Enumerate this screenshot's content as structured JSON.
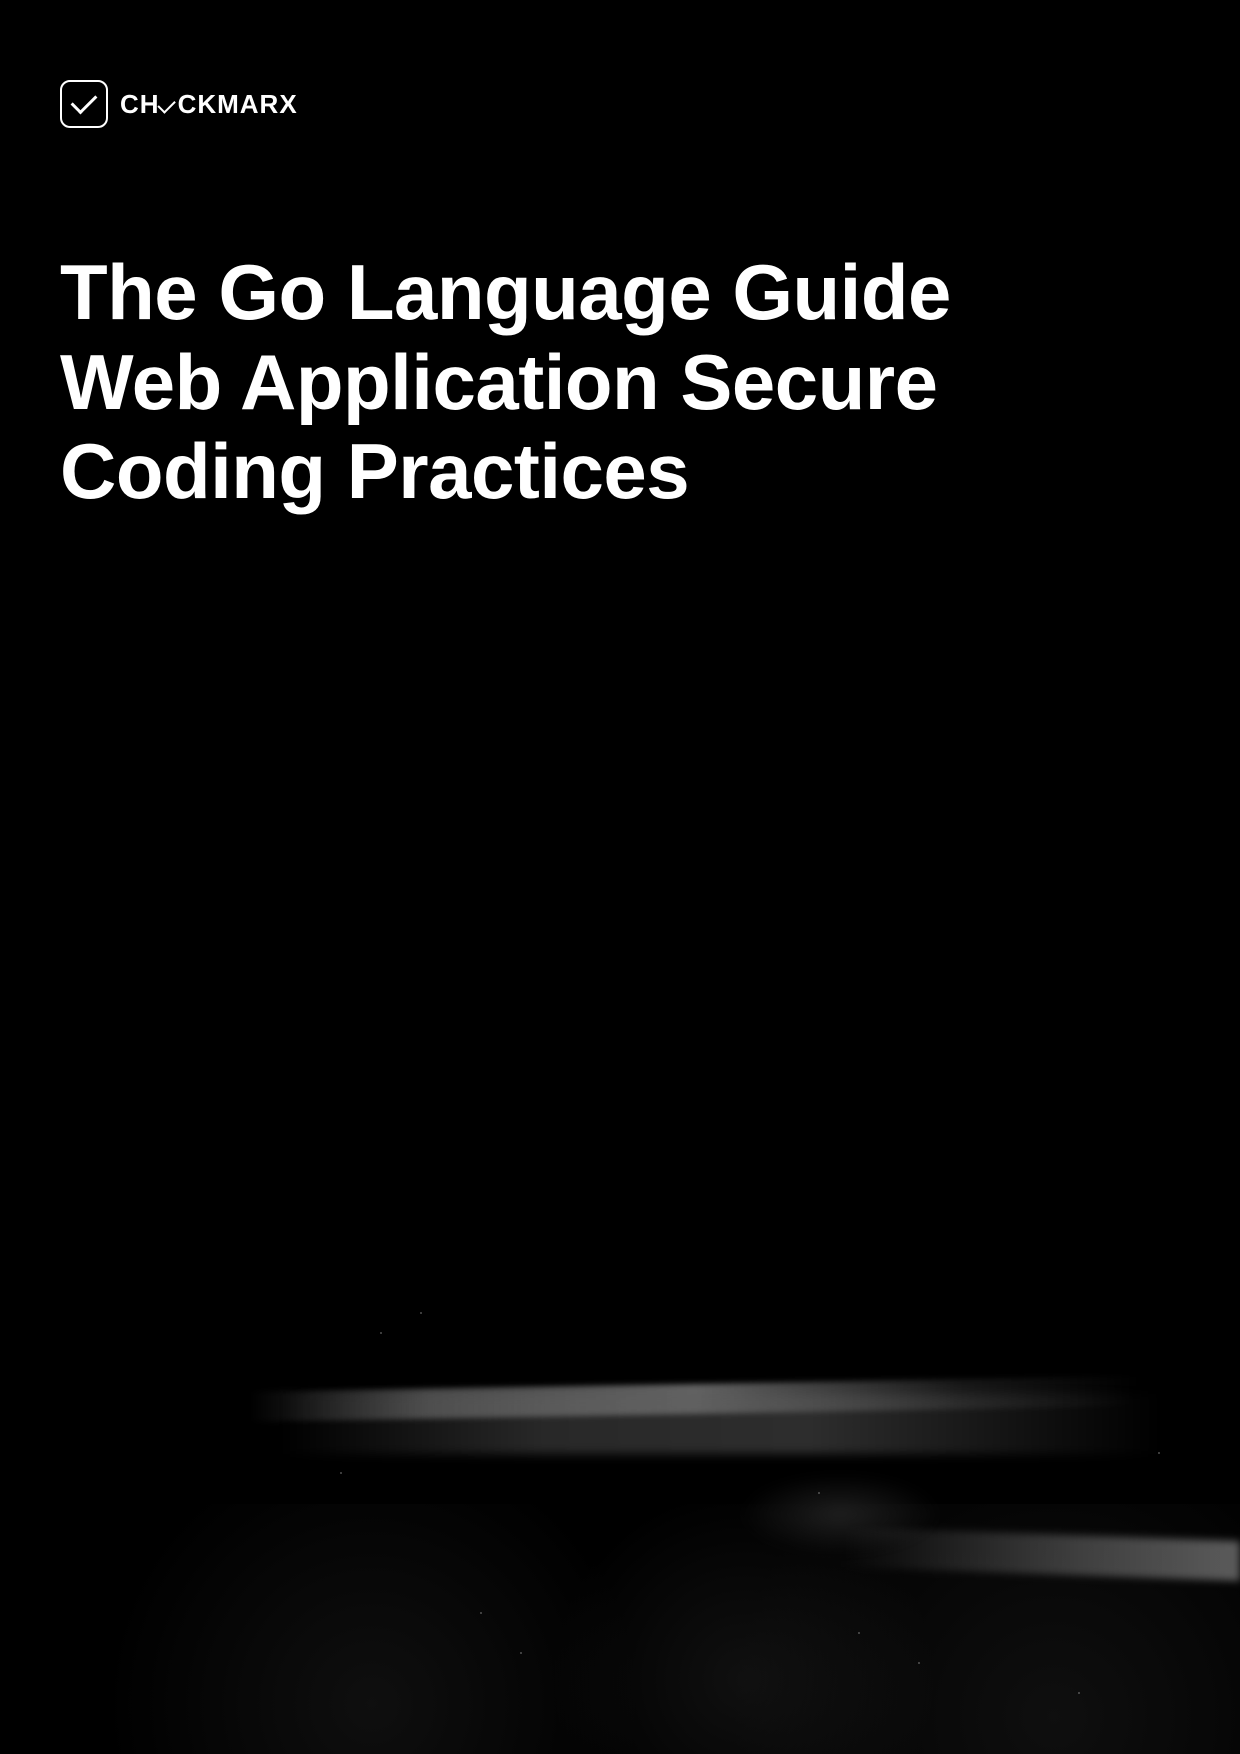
{
  "brand": {
    "name_prefix": "CH",
    "name_suffix": "CKMARX"
  },
  "title": {
    "line1": "The Go Language Guide",
    "line2": "Web Application Secure",
    "line3": "Coding Practices"
  }
}
